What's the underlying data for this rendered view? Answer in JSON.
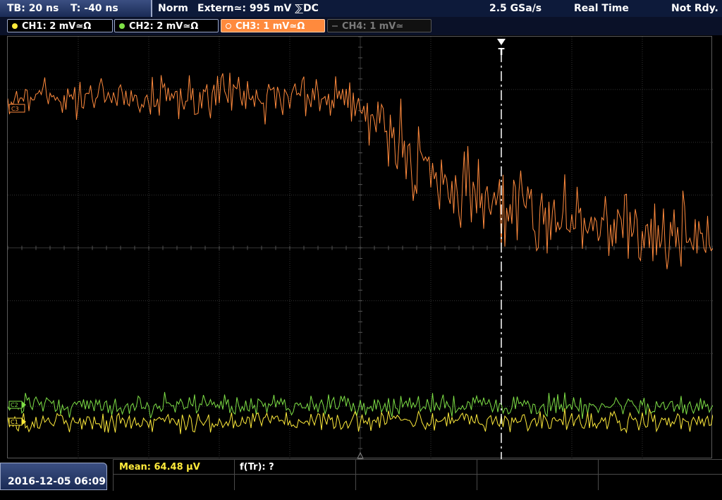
{
  "topbar": {
    "timebase": "TB: 20 ns",
    "trigger_time": "T: -40 ns",
    "trigger_mode": "Norm",
    "trigger_source": "Extern≃: 995 mV ⅀DC",
    "sample_rate": "2.5 GSa/s",
    "acq_mode": "Real Time",
    "status": "Not Rdy."
  },
  "channels": [
    {
      "label": "CH1: 2 mV≃Ω",
      "color": "#ffeb3b",
      "active": true
    },
    {
      "label": "CH2: 2 mV≃Ω",
      "color": "#7ee046",
      "active": true
    },
    {
      "label": "CH3: 1 mV≃Ω",
      "color": "#ff8a3d",
      "active": true
    },
    {
      "label": "CH4: 1 mV≃",
      "color": "#7a7a7a",
      "active": false
    }
  ],
  "screen": {
    "ref_labels": {
      "c1": "C1",
      "c2": "C2",
      "c3": "C3"
    },
    "trigger_marker": "T"
  },
  "bottom": {
    "datetime": "2016-12-05 06:09",
    "mean": "Mean: 64.48 µV",
    "freq": "f(Tr): ?"
  },
  "colors": {
    "ch1": "#ffeb3b",
    "ch2": "#7ee046",
    "ch3": "#ff8a3d",
    "grid": "#3c3c3c"
  }
}
